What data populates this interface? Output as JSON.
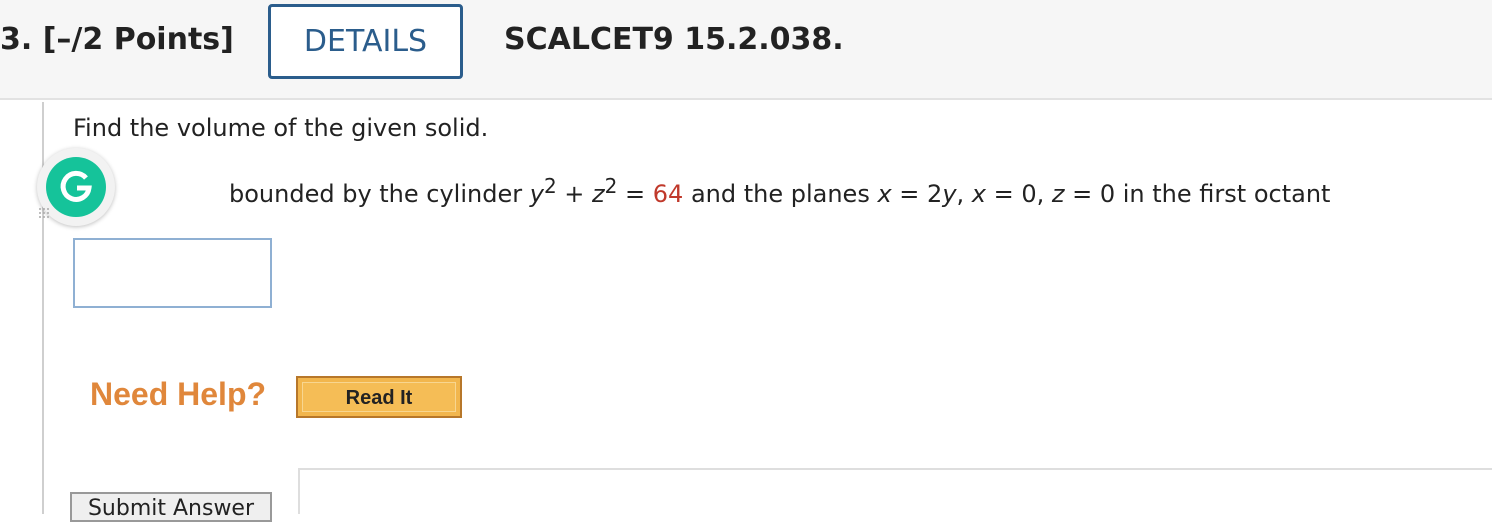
{
  "header": {
    "question_label": "3. [–/2 Points]",
    "details_label": "DETAILS",
    "code": "SCALCET9 15.2.038."
  },
  "question": {
    "prompt": "Find the volume of the given solid.",
    "eq_part1": "bounded by the cylinder ",
    "var_y": "y",
    "exp_1": "2",
    "plus": " + ",
    "var_z": "z",
    "exp_2": "2",
    "equals": " = ",
    "value": "64",
    "eq_part2": " and the planes ",
    "var_x1": "x",
    "eq_part3": " = 2",
    "var_y2": "y",
    "eq_part4": ", ",
    "var_x2": "x",
    "eq_part5": " = 0, ",
    "var_z2": "z",
    "eq_part6": " = 0 in the first octant"
  },
  "answer": {
    "value": ""
  },
  "help": {
    "label": "Need Help?",
    "read_it": "Read It"
  },
  "submit": {
    "label": "Submit Answer"
  },
  "colors": {
    "accent": "#2b5d8c",
    "highlight_value": "#c0392b",
    "help": "#e0873b",
    "read_it_bg": "#f2b64d",
    "grammarly": "#15c39a"
  },
  "icons": {
    "grammarly": "grammarly-g-icon",
    "grip": "drag-grip-icon"
  }
}
